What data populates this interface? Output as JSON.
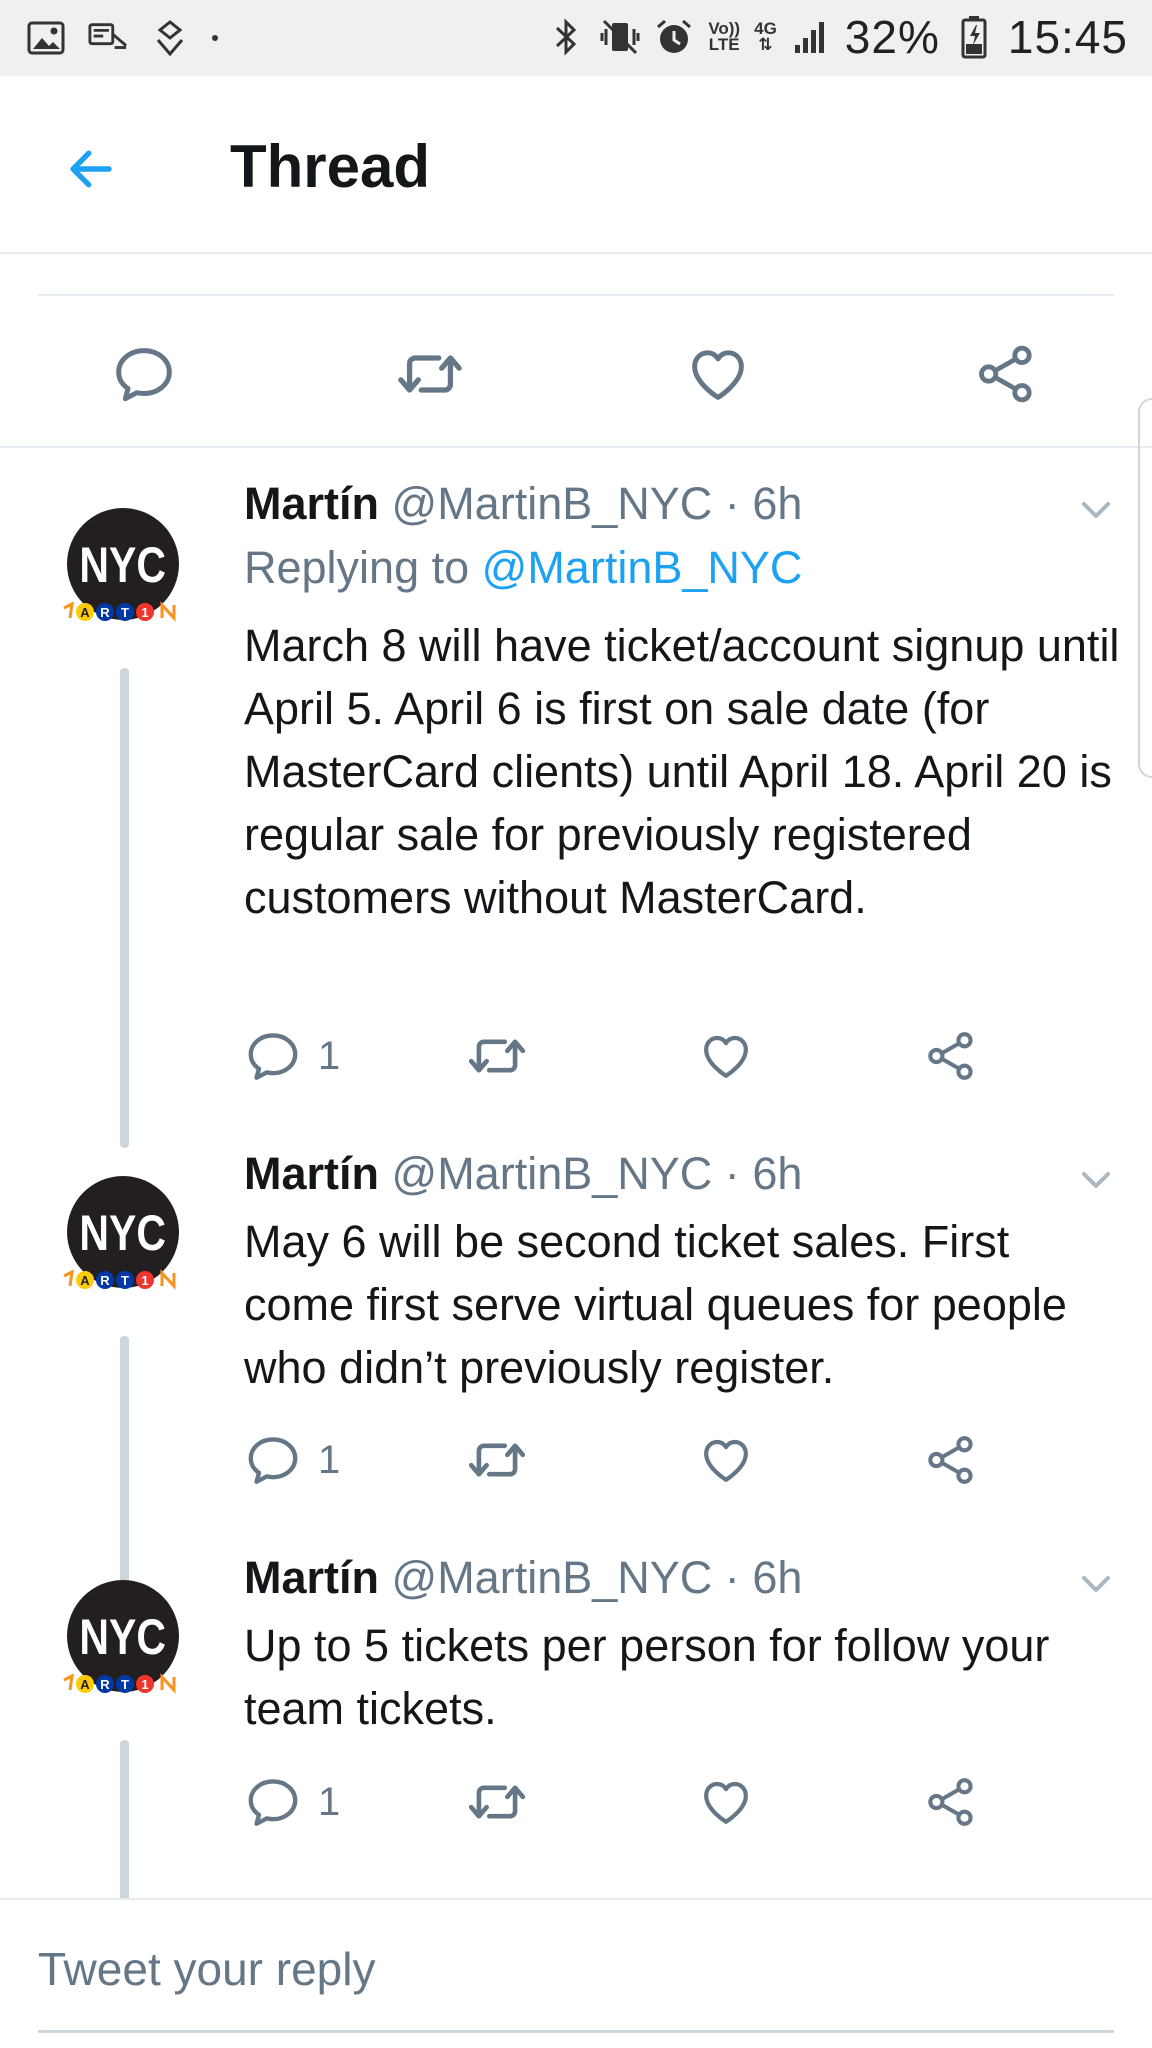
{
  "status_bar": {
    "left_icons": [
      "gallery-icon",
      "cast-icon",
      "sync-icon"
    ],
    "right_icons": [
      "bluetooth-icon",
      "vibrate-icon",
      "alarm-icon"
    ],
    "volte_top": "Vo))",
    "volte_bottom": "LTE",
    "network": "4G",
    "battery": "32%",
    "time": "15:45"
  },
  "header": {
    "title": "Thread"
  },
  "tweets": [
    {
      "name": "Martín",
      "handle": "@MartinB_NYC",
      "separator": "·",
      "time": "6h",
      "replying_to_prefix": "Replying to ",
      "replying_to_handle": "@MartinB_NYC",
      "text": "March 8 will have ticket/account signup until April 5. April 6 is first on sale date (for MasterCard clients) until April 18. April 20 is regular sale for previously registered customers without MasterCard.",
      "reply_count": "1"
    },
    {
      "name": "Martín",
      "handle": "@MartinB_NYC",
      "separator": "·",
      "time": "6h",
      "text": "May 6 will be second ticket sales. First come first serve virtual queues for people who didn’t previously register.",
      "reply_count": "1"
    },
    {
      "name": "Martín",
      "handle": "@MartinB_NYC",
      "separator": "·",
      "time": "6h",
      "text": "Up to 5 tickets per person for follow your team tickets.",
      "reply_count": "1"
    }
  ],
  "avatar": {
    "text": "NYC",
    "letters": [
      "A",
      "R",
      "T",
      "1"
    ]
  },
  "reply_box": {
    "placeholder": "Tweet your reply"
  },
  "colors": {
    "accent": "#1da1f2",
    "text_primary": "#14171a",
    "text_secondary": "#657786",
    "divider": "#e6ecf0",
    "thread_line": "#ccd6dd"
  }
}
